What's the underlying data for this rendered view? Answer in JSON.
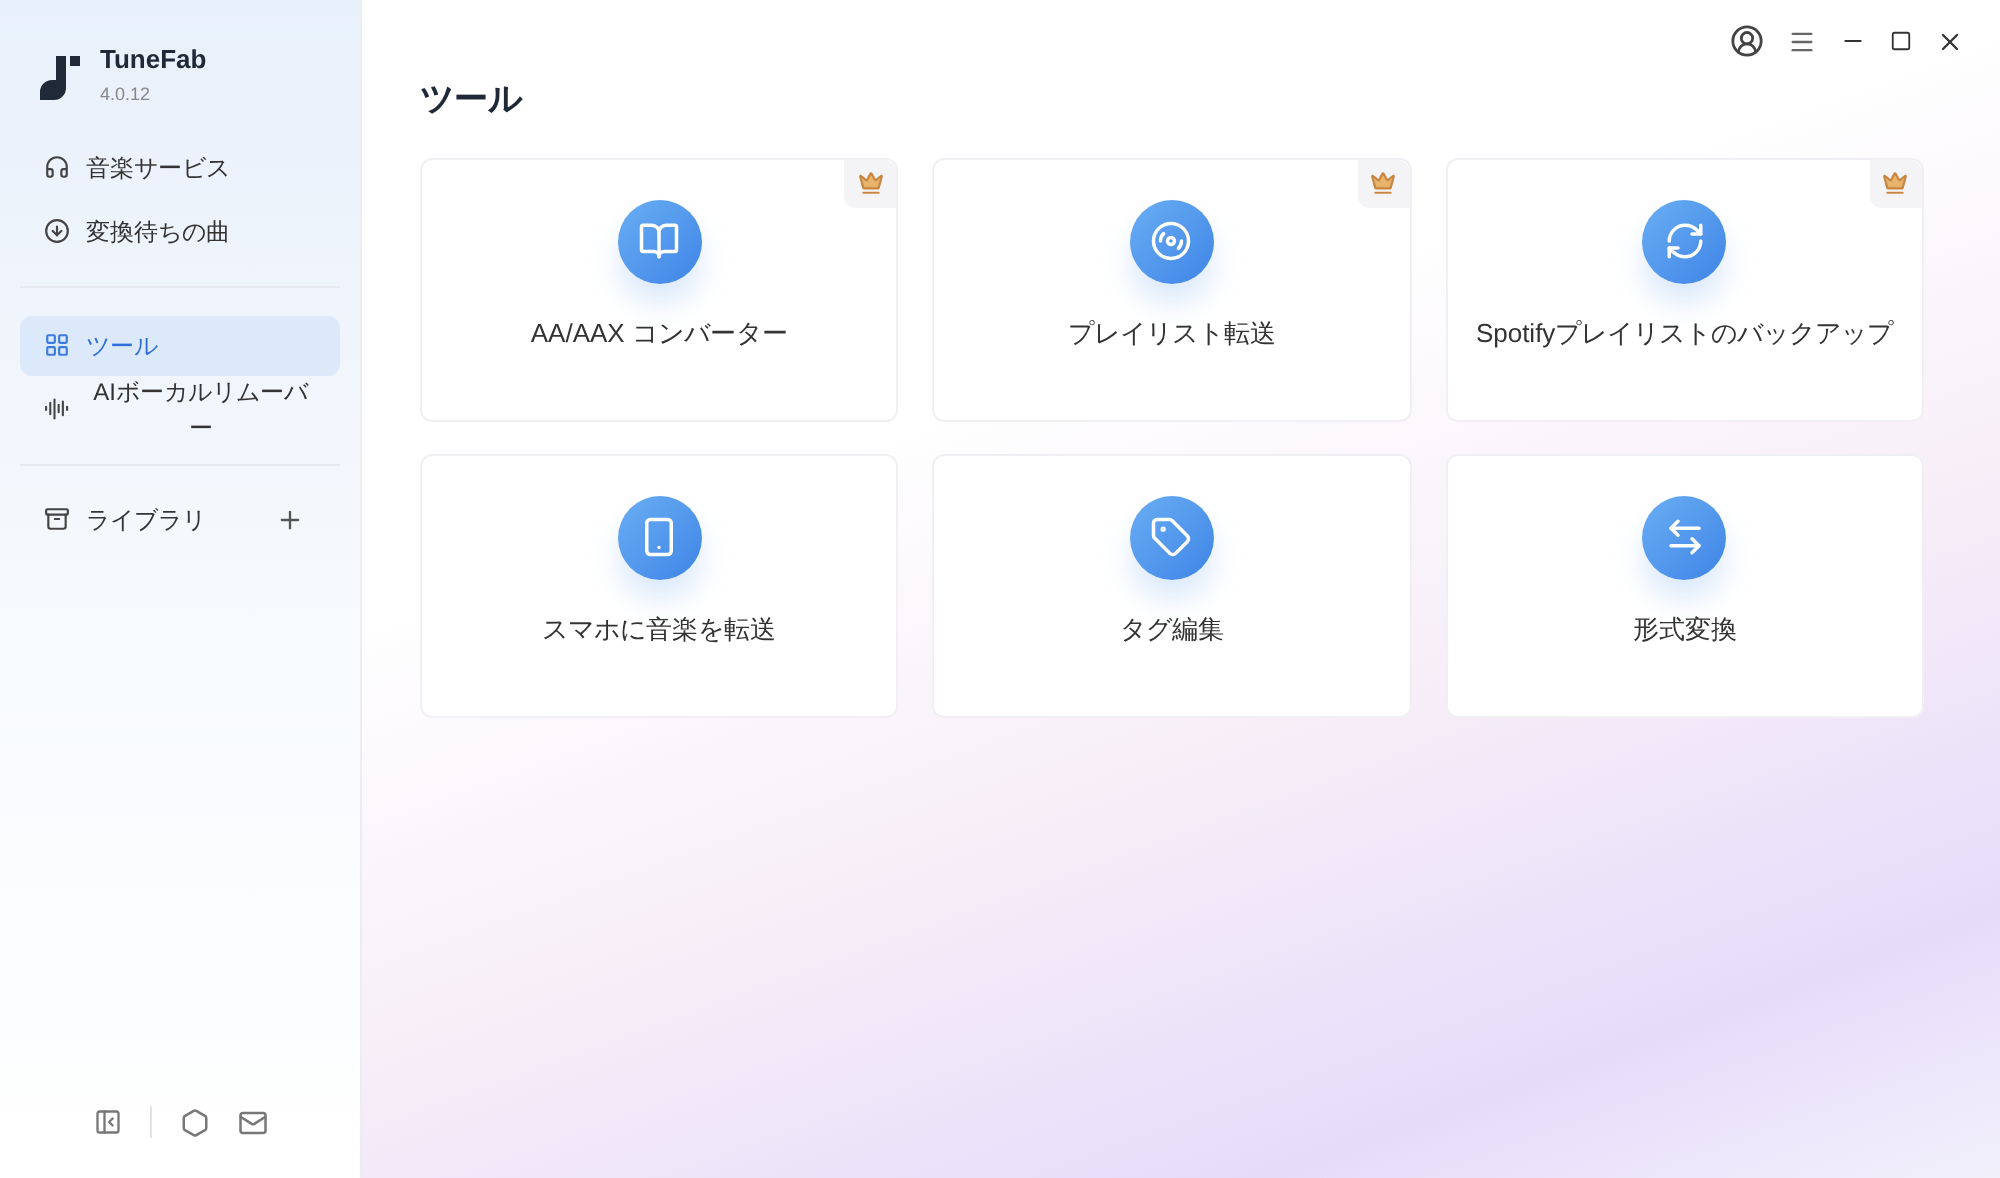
{
  "app": {
    "name": "TuneFab",
    "version": "4.0.12"
  },
  "nav_groups": [
    [
      {
        "label": "音楽サービス",
        "selected": false
      },
      {
        "label": "変換待ちの曲",
        "selected": false
      }
    ],
    [
      {
        "label": "ツール",
        "selected": true
      },
      {
        "label": "AIボーカルリムーバー",
        "selected": false
      }
    ]
  ],
  "library": {
    "label": "ライブラリ"
  },
  "page_title": "ツール",
  "tools": [
    {
      "label": "AA/AAX コンバーター",
      "premium": true
    },
    {
      "label": "プレイリスト転送",
      "premium": true
    },
    {
      "label": "Spotifyプレイリストのバックアップ",
      "premium": true
    },
    {
      "label": "スマホに音楽を転送",
      "premium": false
    },
    {
      "label": "タグ編集",
      "premium": false
    },
    {
      "label": "形式変換",
      "premium": false
    }
  ]
}
